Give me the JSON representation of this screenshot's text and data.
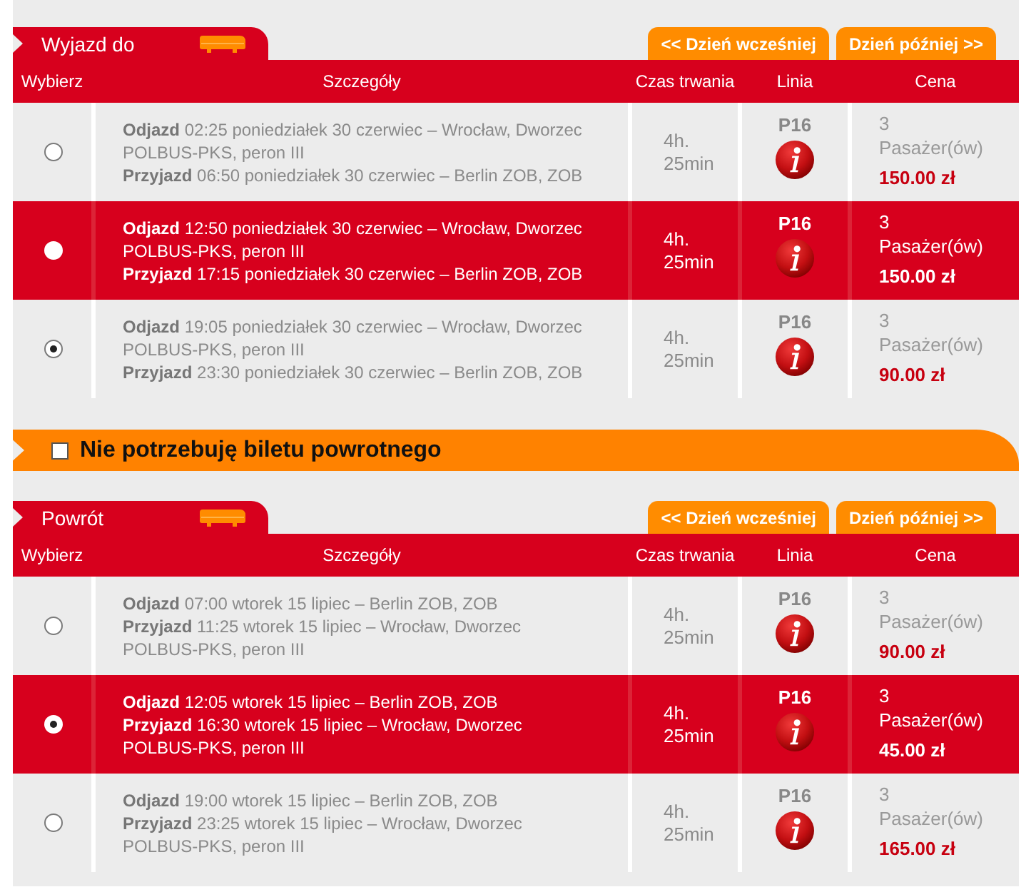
{
  "outbound": {
    "title": "Wyjazd do",
    "prev_day": "<< Dzień wcześniej",
    "next_day": "Dzień później >>",
    "columns": [
      "Wybierz",
      "Szczegóły",
      "Czas trwania",
      "Linia",
      "Cena"
    ],
    "rows": [
      {
        "selected": false,
        "highlighted": false,
        "departure": "**Odjazd** 02:25 poniedziałek 30 czerwiec – Wrocław, Dworzec POLBUS-PKS, peron III",
        "arrival": "**Przyjazd** 06:50 poniedziałek 30 czerwiec – Berlin ZOB, ZOB",
        "duration": "4h. 25min",
        "line": "P16",
        "passengers": "3",
        "passengers_label": "Pasażer(ów)",
        "price": "150.00 zł"
      },
      {
        "selected": false,
        "highlighted": true,
        "departure": "**Odjazd** 12:50 poniedziałek 30 czerwiec – Wrocław, Dworzec POLBUS-PKS, peron III",
        "arrival": "**Przyjazd** 17:15 poniedziałek 30 czerwiec – Berlin ZOB, ZOB",
        "duration": "4h. 25min",
        "line": "P16",
        "passengers": "3",
        "passengers_label": "Pasażer(ów)",
        "price": "150.00 zł"
      },
      {
        "selected": true,
        "highlighted": false,
        "departure": "**Odjazd** 19:05 poniedziałek 30 czerwiec – Wrocław, Dworzec POLBUS-PKS, peron III",
        "arrival": "**Przyjazd** 23:30 poniedziałek 30 czerwiec – Berlin ZOB, ZOB",
        "duration": "4h. 25min",
        "line": "P16",
        "passengers": "3",
        "passengers_label": "Pasażer(ów)",
        "price": "90.00 zł"
      }
    ]
  },
  "return_toggle": {
    "label": "Nie potrzebuję biletu powrotnego",
    "checked": false
  },
  "return_trip": {
    "title": "Powrót",
    "prev_day": "<< Dzień wcześniej",
    "next_day": "Dzień później >>",
    "columns": [
      "Wybierz",
      "Szczegóły",
      "Czas trwania",
      "Linia",
      "Cena"
    ],
    "rows": [
      {
        "selected": false,
        "highlighted": false,
        "departure": "**Odjazd** 07:00 wtorek 15 lipiec – Berlin ZOB, ZOB",
        "arrival": "**Przyjazd** 11:25 wtorek 15 lipiec – Wrocław, Dworzec POLBUS-PKS, peron III",
        "duration": "4h. 25min",
        "line": "P16",
        "passengers": "3",
        "passengers_label": "Pasażer(ów)",
        "price": "90.00 zł"
      },
      {
        "selected": true,
        "highlighted": true,
        "departure": "**Odjazd** 12:05 wtorek 15 lipiec – Berlin ZOB, ZOB",
        "arrival": "**Przyjazd** 16:30 wtorek 15 lipiec – Wrocław, Dworzec POLBUS-PKS, peron III",
        "duration": "4h. 25min",
        "line": "P16",
        "passengers": "3",
        "passengers_label": "Pasażer(ów)",
        "price": "45.00 zł"
      },
      {
        "selected": false,
        "highlighted": false,
        "departure": "**Odjazd** 19:00 wtorek 15 lipiec – Berlin ZOB, ZOB",
        "arrival": "**Przyjazd** 23:25 wtorek 15 lipiec – Wrocław, Dworzec POLBUS-PKS, peron III",
        "duration": "4h. 25min",
        "line": "P16",
        "passengers": "3",
        "passengers_label": "Pasażer(ów)",
        "price": "165.00 zł"
      }
    ]
  }
}
